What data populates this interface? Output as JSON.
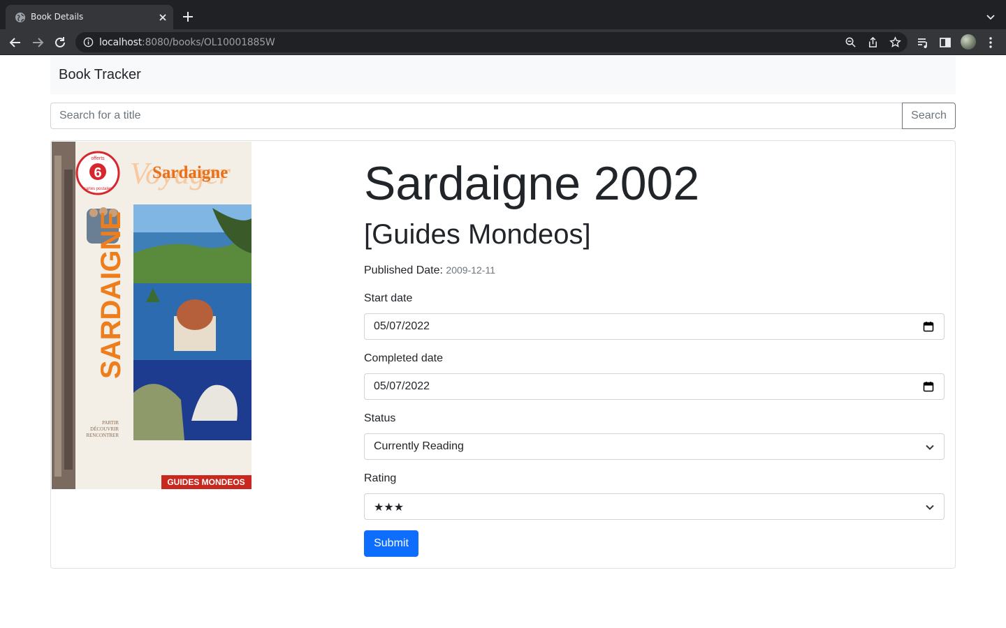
{
  "browser": {
    "tab_title": "Book Details",
    "url_host": "localhost",
    "url_path": ":8080/books/OL10001885W"
  },
  "navbar": {
    "brand": "Book Tracker"
  },
  "search": {
    "placeholder": "Search for a title",
    "button_label": "Search"
  },
  "book": {
    "cover_texts": {
      "series_watermark": "Voyager",
      "cover_title": "Sardaigne",
      "spine_title": "SARDAIGNE",
      "badge_number": "6",
      "badge_text_1": "offerts",
      "badge_text_2": "cartes postales",
      "tagline_1": "PARTIR",
      "tagline_2": "DÉCOUVRIR",
      "tagline_3": "RENCONTRER",
      "publisher_banner": "GUIDES MONDEOS"
    },
    "title": "Sardaigne 2002",
    "subtitle": "[Guides Mondeos]",
    "published_label": "Published Date:",
    "published_value": "2009-12-11"
  },
  "form": {
    "start_date_label": "Start date",
    "start_date_value": "05/07/2022",
    "completed_date_label": "Completed date",
    "completed_date_value": "05/07/2022",
    "status_label": "Status",
    "status_value": "Currently Reading",
    "rating_label": "Rating",
    "rating_value": "★★★",
    "rating_stars": 3,
    "submit_label": "Submit"
  },
  "colors": {
    "primary": "#0d6efd",
    "navbar_bg": "#f8f9fa",
    "chrome_dark": "#202124",
    "chrome_toolbar": "#35363a"
  }
}
